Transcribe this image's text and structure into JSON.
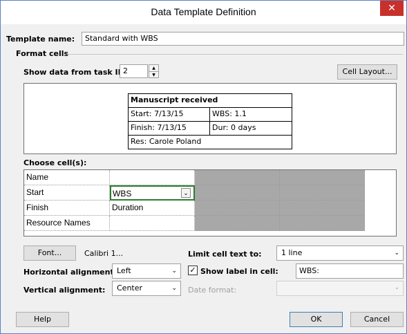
{
  "window": {
    "title": "Data Template Definition",
    "close_glyph": "✕"
  },
  "template_name": {
    "label": "Template name:",
    "value": "Standard with WBS"
  },
  "format_cells": {
    "group_label": "Format cells",
    "show_data_label": "Show data from task ID:",
    "task_id": "2",
    "spin_up": "▲",
    "spin_down": "▼",
    "cell_layout_button": "Cell Layout..."
  },
  "preview": {
    "title": "Manuscript received",
    "start": "Start: 7/13/15",
    "wbs": "WBS: 1.1",
    "finish": "Finish: 7/13/15",
    "dur": "Dur: 0 days",
    "res": "Res:   Carole Poland"
  },
  "choose_cells": {
    "label": "Choose cell(s):",
    "rows": [
      {
        "c1": "Name",
        "c2": ""
      },
      {
        "c1": "Start",
        "c2": "WBS"
      },
      {
        "c1": "Finish",
        "c2": "Duration"
      },
      {
        "c1": "Resource Names",
        "c2": ""
      }
    ]
  },
  "font": {
    "button": "Font...",
    "value": "Calibri 1..."
  },
  "horizontal_alignment": {
    "label": "Horizontal alignment:",
    "value": "Left"
  },
  "vertical_alignment": {
    "label": "Vertical alignment:",
    "value": "Center"
  },
  "limit_cell_text": {
    "label": "Limit cell text to:",
    "value": "1 line"
  },
  "show_label": {
    "label": "Show label in cell:",
    "checked": true,
    "value": "WBS:"
  },
  "date_format": {
    "label": "Date format:",
    "value": ""
  },
  "buttons": {
    "help": "Help",
    "ok": "OK",
    "cancel": "Cancel"
  },
  "icons": {
    "dropdown": "chevron-down-icon",
    "check": "checkmark-icon"
  },
  "colors": {
    "close_red": "#c8302b",
    "gray_cells": "#a8a8a8",
    "selected_border": "#2f7a2f"
  }
}
